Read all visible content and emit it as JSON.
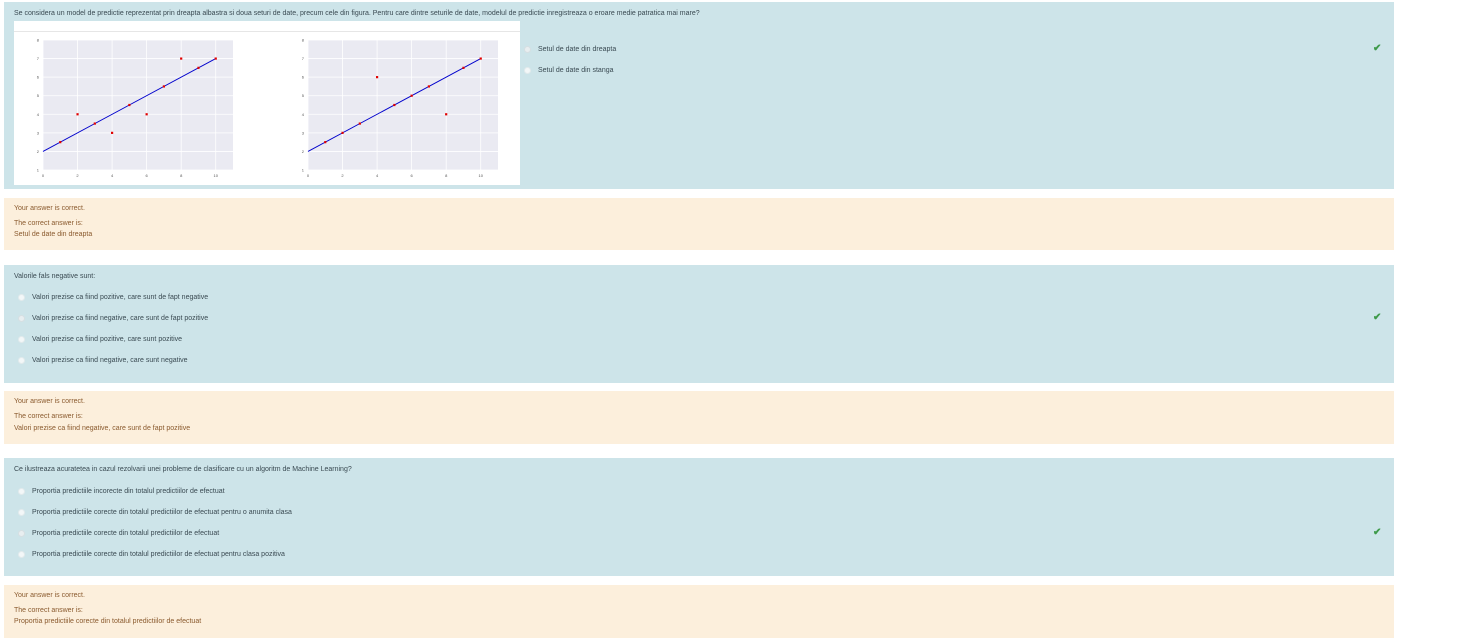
{
  "questions": [
    {
      "text": "Se considera un model de predictie reprezentat prin dreapta albastra si doua seturi de date, precum cele din figura. Pentru care dintre seturile de date, modelul de predictie inregistreaza o eroare medie patratica mai mare?",
      "options": [
        {
          "label": "Setul de date din dreapta",
          "selected": true
        },
        {
          "label": "Setul de date din stanga",
          "selected": false
        }
      ],
      "feedback": {
        "status": "Your answer is correct.",
        "intro": "The correct answer is:",
        "answer": "Setul de date din dreapta"
      }
    },
    {
      "text": "Valorile fals negative sunt:",
      "options": [
        {
          "label": "Valori prezise ca fiind pozitive, care sunt de fapt negative",
          "selected": false
        },
        {
          "label": "Valori prezise ca fiind negative, care sunt de fapt pozitive",
          "selected": true
        },
        {
          "label": "Valori prezise ca fiind pozitive, care sunt pozitive",
          "selected": false
        },
        {
          "label": "Valori prezise ca fiind negative, care sunt negative",
          "selected": false
        }
      ],
      "feedback": {
        "status": "Your answer is correct.",
        "intro": "The correct answer is:",
        "answer": "Valori prezise ca fiind negative, care sunt de fapt pozitive"
      }
    },
    {
      "text": "Ce ilustreaza acuratetea in cazul rezolvarii unei probleme de clasificare cu un algoritm de Machine Learning?",
      "options": [
        {
          "label": "Proportia predictiile incorecte din totalul predictiilor de efectuat",
          "selected": false
        },
        {
          "label": "Proportia predictiile corecte din totalul predictiilor de efectuat pentru o anumita clasa",
          "selected": false
        },
        {
          "label": "Proportia predictiile corecte din totalul predictiilor de efectuat",
          "selected": true
        },
        {
          "label": "Proportia predictiile corecte din totalul predictiilor de efectuat pentru clasa pozitiva",
          "selected": false
        }
      ],
      "feedback": {
        "status": "Your answer is correct.",
        "intro": "The correct answer is:",
        "answer": "Proportia predictiile corecte din totalul predictiilor de efectuat"
      }
    }
  ],
  "icons": {
    "correct": "check-icon"
  },
  "colors": {
    "question_bg": "#cde4e9",
    "feedback_bg": "#fcefdc",
    "check": "#3e9a4a",
    "line": "#0000cc",
    "points": "#e00000"
  },
  "chart_data": [
    {
      "type": "scatter",
      "xlim": [
        0,
        11
      ],
      "ylim": [
        1,
        8
      ],
      "xticks": [
        "0",
        "2",
        "4",
        "6",
        "8",
        "10"
      ],
      "yticks": [
        "1",
        "2",
        "3",
        "4",
        "5",
        "6",
        "7",
        "8"
      ],
      "line": {
        "x": [
          0,
          10
        ],
        "y": [
          2,
          7
        ]
      },
      "points": [
        [
          1,
          2.5
        ],
        [
          2,
          4
        ],
        [
          3,
          3.5
        ],
        [
          4,
          3
        ],
        [
          5,
          4.5
        ],
        [
          6,
          4
        ],
        [
          7,
          5.5
        ],
        [
          8,
          7
        ],
        [
          9,
          6.5
        ],
        [
          10,
          7
        ]
      ]
    },
    {
      "type": "scatter",
      "xlim": [
        0,
        11
      ],
      "ylim": [
        1,
        8
      ],
      "xticks": [
        "0",
        "2",
        "4",
        "6",
        "8",
        "10"
      ],
      "yticks": [
        "1",
        "2",
        "3",
        "4",
        "5",
        "6",
        "7",
        "8"
      ],
      "line": {
        "x": [
          0,
          10
        ],
        "y": [
          2,
          7
        ]
      },
      "points": [
        [
          1,
          2.5
        ],
        [
          2,
          3
        ],
        [
          3,
          3.5
        ],
        [
          4,
          6
        ],
        [
          5,
          4.5
        ],
        [
          6,
          5
        ],
        [
          7,
          5.5
        ],
        [
          8,
          4
        ],
        [
          9,
          6.5
        ],
        [
          10,
          7
        ]
      ]
    }
  ]
}
